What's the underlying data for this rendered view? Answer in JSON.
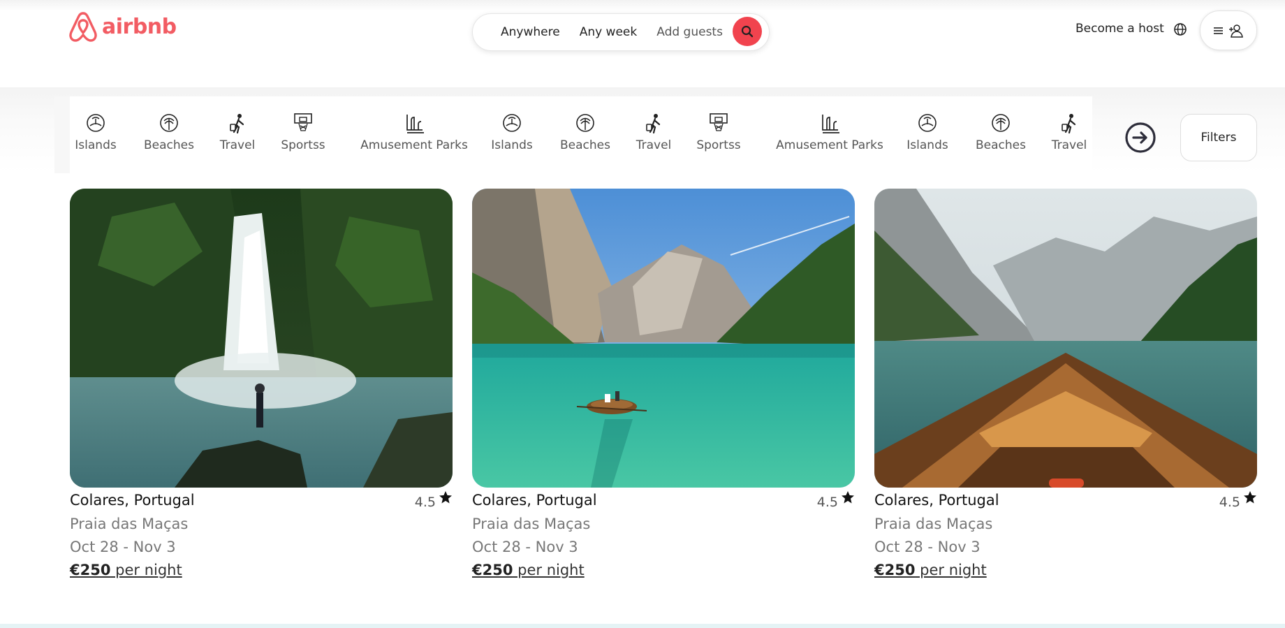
{
  "brand": {
    "name": "airbnb",
    "color": "#f25c63"
  },
  "search": {
    "anywhere": "Anywhere",
    "any_week": "Any week",
    "add_guests": "Add guests",
    "button_icon": "search-icon"
  },
  "header": {
    "become_host": "Become a host",
    "globe_icon": "globe-icon",
    "menu_icon": "hamburger-icon",
    "user_icon": "user-add-icon"
  },
  "categories": [
    {
      "label": "Islands",
      "icon": "island-icon"
    },
    {
      "label": "Beaches",
      "icon": "palm-icon"
    },
    {
      "label": "Travel",
      "icon": "traveler-icon"
    },
    {
      "label": "Sportss",
      "icon": "basketball-hoop-icon"
    },
    {
      "label": "Amusement Parks",
      "icon": "roller-coaster-icon"
    },
    {
      "label": "Islands",
      "icon": "island-icon"
    },
    {
      "label": "Beaches",
      "icon": "palm-icon"
    },
    {
      "label": "Travel",
      "icon": "traveler-icon"
    },
    {
      "label": "Sportss",
      "icon": "basketball-hoop-icon"
    },
    {
      "label": "Amusement Parks",
      "icon": "roller-coaster-icon"
    },
    {
      "label": "Islands",
      "icon": "island-icon"
    },
    {
      "label": "Beaches",
      "icon": "palm-icon"
    },
    {
      "label": "Travel",
      "icon": "traveler-icon"
    }
  ],
  "filters_label": "Filters",
  "listings": [
    {
      "title": "Colares, Portugal",
      "rating": "4.5",
      "subtitle": "Praia das Maças",
      "dates": "Oct 28 - Nov 3",
      "price": "€250",
      "price_suffix": " per night",
      "image": "waterfall-photo"
    },
    {
      "title": "Colares, Portugal",
      "rating": "4.5",
      "subtitle": "Praia das Maças",
      "dates": "Oct 28 - Nov 3",
      "price": "€250",
      "price_suffix": " per night",
      "image": "turquoise-lake-boat-photo"
    },
    {
      "title": "Colares, Portugal",
      "rating": "4.5",
      "subtitle": "Praia das Maças",
      "dates": "Oct 28 - Nov 3",
      "price": "€250",
      "price_suffix": " per night",
      "image": "wooden-boat-bow-photo"
    }
  ]
}
